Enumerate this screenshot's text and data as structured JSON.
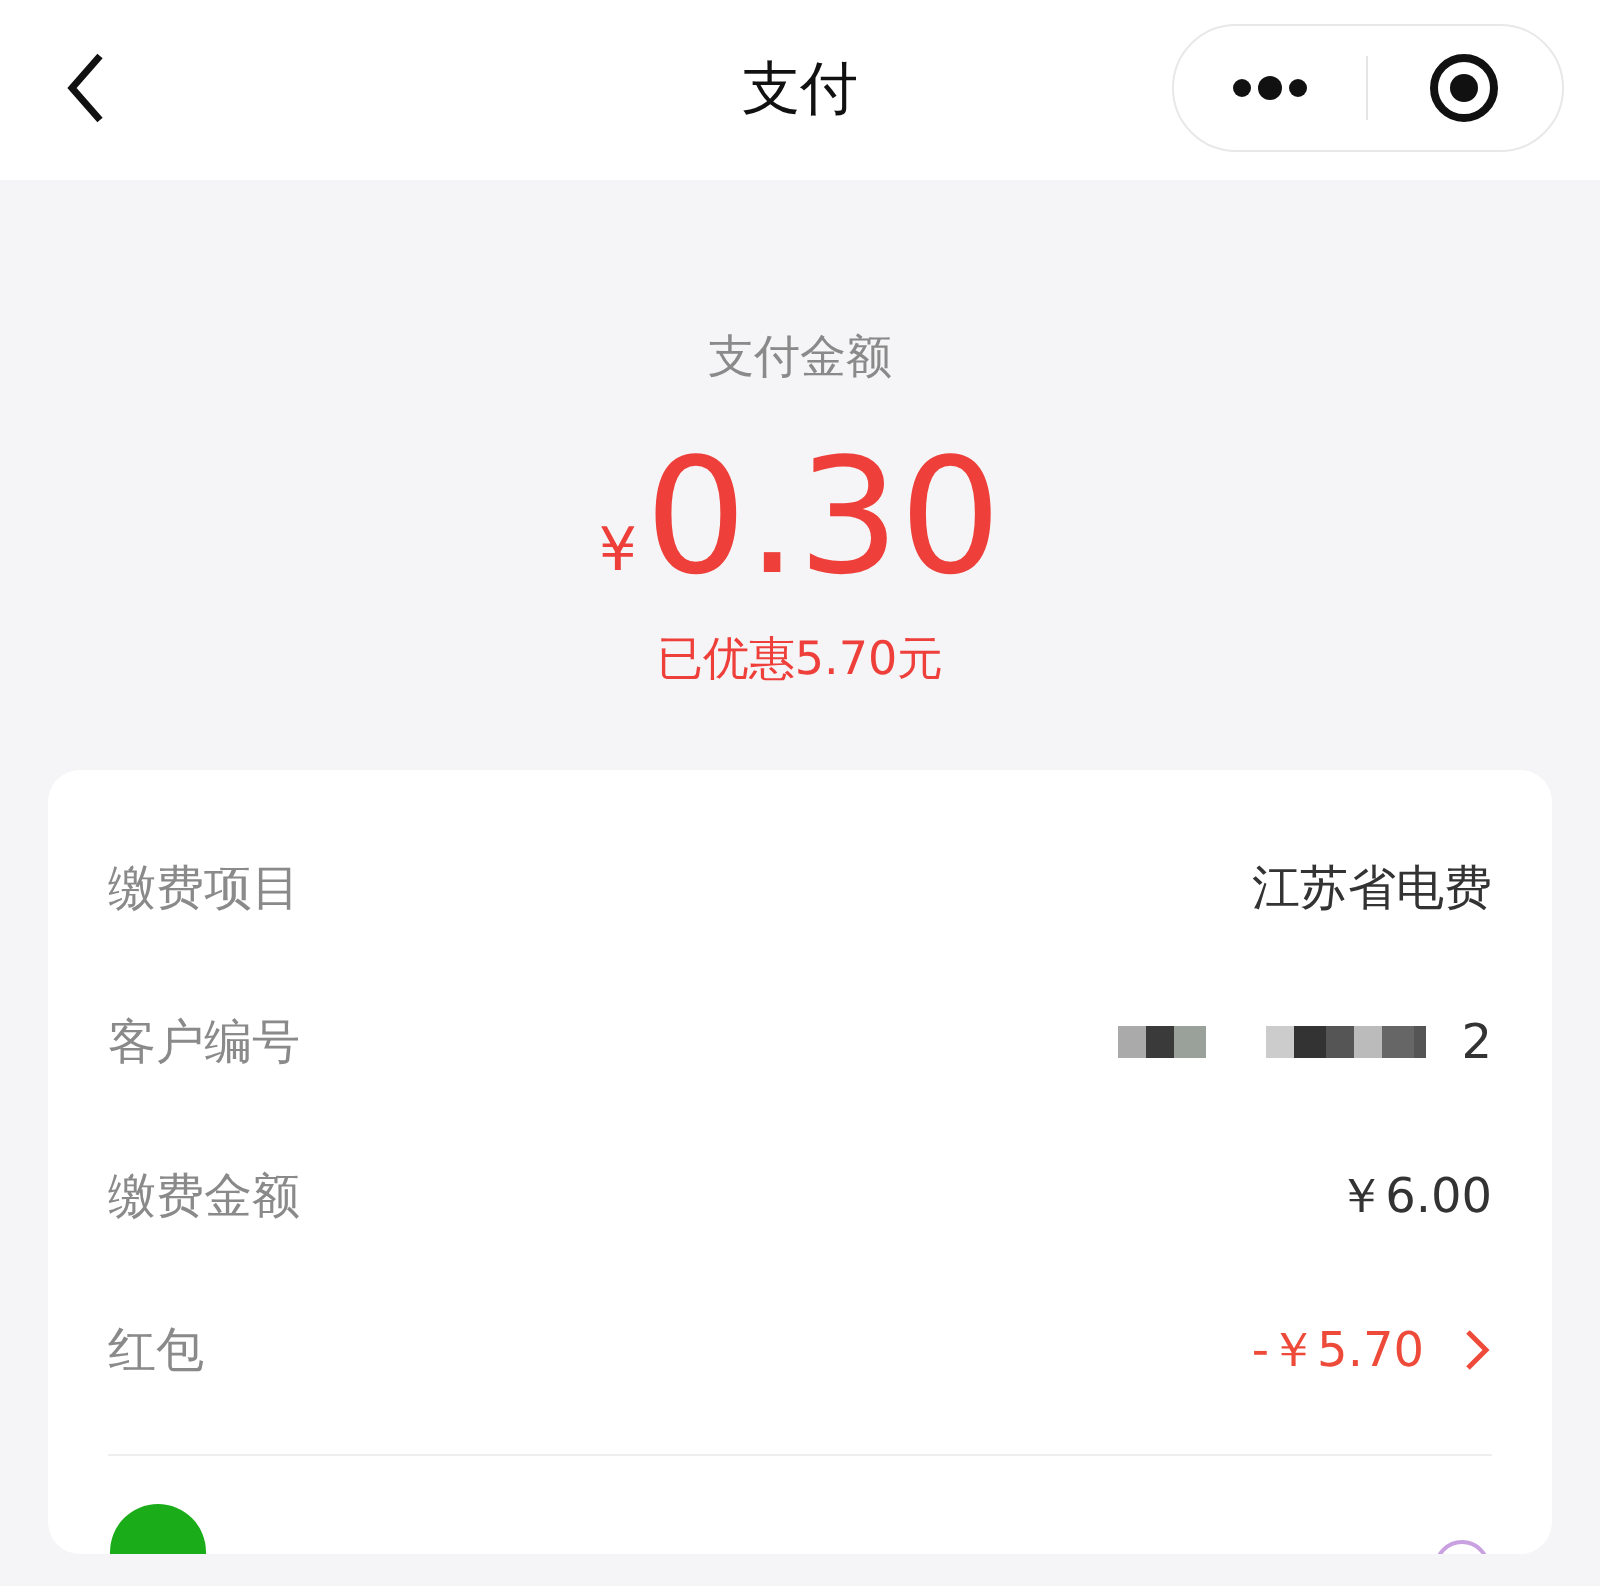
{
  "nav": {
    "title": "支付"
  },
  "amount": {
    "label": "支付金额",
    "currency": "¥",
    "value": "0.30",
    "discount": "已优惠5.70元"
  },
  "details": [
    {
      "kind": "text",
      "label": "缴费项目",
      "value": "江苏省电费"
    },
    {
      "kind": "masked",
      "label": "客户编号",
      "value": "2"
    },
    {
      "kind": "text",
      "label": "缴费金额",
      "value": "￥6.00"
    },
    {
      "kind": "link",
      "label": "红包",
      "value": "-￥5.70"
    }
  ]
}
